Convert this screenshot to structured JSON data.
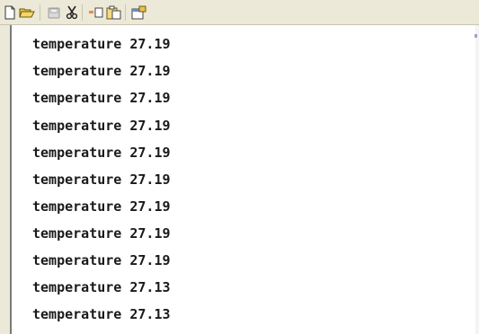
{
  "toolbar": {
    "icons": [
      "new-document-icon",
      "open-folder-icon",
      "save-disabled-icon",
      "cut-icon",
      "copy-icon",
      "paste-icon",
      "properties-icon"
    ]
  },
  "console": {
    "lines": [
      "temperature 27.19",
      "temperature 27.19",
      "temperature 27.19",
      "temperature 27.19",
      "temperature 27.19",
      "temperature 27.19",
      "temperature 27.19",
      "temperature 27.19",
      "temperature 27.19",
      "temperature 27.13",
      "temperature 27.13"
    ]
  },
  "colors": {
    "toolbar_bg": "#ece9d8",
    "text": "#1a1a1a",
    "console_bg": "#ffffff"
  }
}
